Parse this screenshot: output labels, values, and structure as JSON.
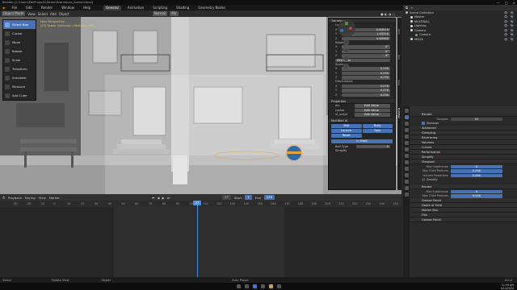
{
  "titlebar": {
    "title": "Blender [C:\\Users\\Me\\Projects\\Street\\Townhouse_Scene.blend]",
    "controls": [
      "—",
      "□",
      "✕"
    ]
  },
  "menubar": {
    "menus": [
      "File",
      "Edit",
      "Render",
      "Window",
      "Help"
    ],
    "workspaces": [
      "General",
      "Animation",
      "Scripting",
      "Shading",
      "Geometry Nodes"
    ],
    "active_workspace": "General",
    "scene_label": "Scene",
    "viewlayer_label": "ViewLayer"
  },
  "viewport": {
    "mode": "Object Mode",
    "menus": [
      "View",
      "Select",
      "Add",
      "Object"
    ],
    "orientation": "Normal",
    "snap": "Mir",
    "overlay_line1": "User Perspective",
    "overlay_line2": "(27) Scene Collection | MultiBall.001"
  },
  "tools": [
    {
      "label": "Select Box",
      "icon": "select-box-icon",
      "selected": true
    },
    {
      "label": "Cursor",
      "icon": "cursor-icon",
      "selected": false
    },
    {
      "label": "Move",
      "icon": "move-icon",
      "selected": false
    },
    {
      "label": "Rotate",
      "icon": "rotate-icon",
      "selected": false
    },
    {
      "label": "Scale",
      "icon": "scale-icon",
      "selected": false
    },
    {
      "label": "Transform",
      "icon": "transform-icon",
      "selected": false
    },
    {
      "label": "Annotate",
      "icon": "annotate-icon",
      "selected": false
    },
    {
      "label": "Measure",
      "icon": "measure-icon",
      "selected": false
    },
    {
      "label": "Add Cube",
      "icon": "add-cube-icon",
      "selected": false
    }
  ],
  "npanel": {
    "transform_title": "Transform",
    "location_label": "Location:",
    "location": [
      {
        "axis": "X",
        "value": "0.63519"
      },
      {
        "axis": "Y",
        "value": "1.45316"
      },
      {
        "axis": "Z",
        "value": "0.60960"
      }
    ],
    "rotation_label": "Rotation:",
    "rotation": [
      {
        "axis": "X",
        "value": "0°"
      },
      {
        "axis": "Y",
        "value": "0°"
      },
      {
        "axis": "Z",
        "value": "0°"
      }
    ],
    "rotation_mode": "XYZ Euler",
    "scale_label": "Scale:",
    "scale": [
      {
        "axis": "X",
        "value": "0.230"
      },
      {
        "axis": "Y",
        "value": "0.230"
      },
      {
        "axis": "Z",
        "value": "0.230"
      }
    ],
    "dimensions_label": "Dimensions:",
    "dimensions": [
      {
        "axis": "X",
        "value": "0.276"
      },
      {
        "axis": "Y",
        "value": "0.276"
      },
      {
        "axis": "Z",
        "value": "0.230"
      }
    ],
    "properties_title": "Properties",
    "prop_rows": [
      {
        "key": "etc",
        "btn": "Edit Value"
      },
      {
        "key": "cycles",
        "btn": "Edit Value"
      },
      {
        "key": "ui_script",
        "btn": "Edit Value"
      }
    ],
    "multiball_title": "MultiBall UI",
    "mb_buttons": [
      "Roll",
      "Bully",
      "Launch",
      "Spin",
      "Reset"
    ],
    "mb_primary": "In Front",
    "ball_type_label": "Ball Type",
    "ball_type_value": "0",
    "simplify_label": "Simplify",
    "side_tabs": [
      "Item",
      "Tool",
      "View",
      "MultiBall"
    ]
  },
  "outliner": {
    "header": "Scene Collection",
    "items": [
      {
        "label": "Scene Collection",
        "indent": 0,
        "color": "#bbbbbb"
      },
      {
        "label": "Master",
        "indent": 1,
        "color": "#e0e0e0"
      },
      {
        "label": "MULTIBALL",
        "indent": 1,
        "color": "#e0e0e0"
      },
      {
        "label": "Lighting",
        "indent": 1,
        "color": "#e0e0e0"
      },
      {
        "label": "Camera",
        "indent": 1,
        "color": "#e0e0e0"
      },
      {
        "label": "Camera",
        "indent": 2,
        "color": "#5fb45f"
      },
      {
        "label": "MISTA",
        "indent": 1,
        "color": "#e0e0e0"
      }
    ]
  },
  "properties": {
    "render_title": "Render",
    "samples_label": "Samples",
    "samples_value": "64",
    "shadows_label": "Shadows",
    "sections": [
      "Advanced",
      "Clamping",
      "Raytracing",
      "Volumes",
      "Curves",
      "Performance",
      "Simplify",
      "Viewport"
    ],
    "viewport_rows": [
      {
        "label": "Max Subdivision",
        "value": "0"
      },
      {
        "label": "Max Child Particles",
        "value": "0.000"
      },
      {
        "label": "Volume Resolution",
        "value": "0.000"
      }
    ],
    "simplify_cb": "Simplify",
    "render2_title": "Render",
    "render_rows": [
      {
        "label": "Max Subdivision",
        "value": "0"
      },
      {
        "label": "Max Child Particles",
        "value": "0.000"
      }
    ],
    "bottom_sections": [
      "Grease Pencil",
      "Depth of Field",
      "Motion Blur",
      "Film",
      "Grease Pencil"
    ]
  },
  "timeline": {
    "menus": [
      "Playback",
      "Keying",
      "View",
      "Marker"
    ],
    "current_frame": "27",
    "start_label": "Start",
    "start_value": "1",
    "end_label": "End",
    "end_value": "250",
    "ticks": [
      "-30",
      "-20",
      "-10",
      "0",
      "10",
      "20",
      "30",
      "40",
      "50",
      "60",
      "70",
      "80",
      "90",
      "100",
      "110",
      "120",
      "130",
      "140",
      "150",
      "160",
      "170",
      "180",
      "190",
      "200",
      "210",
      "220",
      "230",
      "240",
      "250"
    ]
  },
  "statusbar": {
    "items": [
      "Select",
      "Rotate View",
      "Object"
    ],
    "center": "Auto Player",
    "version": "4.0.2"
  },
  "taskbar": {
    "time": "11:59 AM",
    "date": "4/14/2024"
  }
}
